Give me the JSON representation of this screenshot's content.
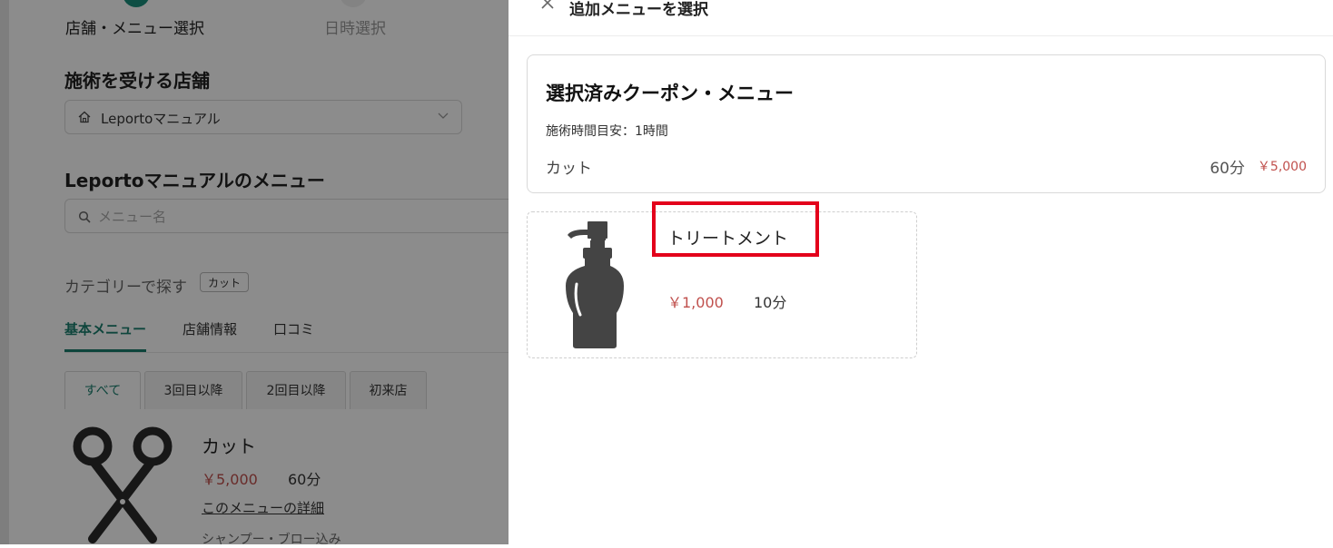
{
  "steps": [
    {
      "label": "店舗・メニュー選択",
      "state": "active"
    },
    {
      "label": "日時選択",
      "state": "inactive"
    }
  ],
  "store_section": {
    "title": "施術を受ける店舗",
    "selected_store": "Leportoマニュアル",
    "icon": "home-icon"
  },
  "menu_section": {
    "title": "Leportoマニュアルのメニュー",
    "search_placeholder": "メニュー名",
    "category_label": "カテゴリーで探す",
    "category_tag": "カット"
  },
  "main_tabs": [
    {
      "label": "基本メニュー",
      "active": true
    },
    {
      "label": "店舗情報",
      "active": false
    },
    {
      "label": "口コミ",
      "active": false
    }
  ],
  "filter_tabs": [
    {
      "label": "すべて",
      "active": true
    },
    {
      "label": "3回目以降",
      "active": false
    },
    {
      "label": "2回目以降",
      "active": false
    },
    {
      "label": "初来店",
      "active": false
    }
  ],
  "menu_item": {
    "name": "カット",
    "price": "￥5,000",
    "duration": "60分",
    "detail_link": "このメニューの詳細",
    "description": "シャンプー・ブロー込み",
    "icon": "scissors-icon"
  },
  "drawer": {
    "title": "追加メニューを選択",
    "selected": {
      "title": "選択済みクーポン・メニュー",
      "time_estimate": "施術時間目安：1時間",
      "item_name": "カット",
      "item_duration": "60分",
      "item_price": "￥5,000"
    },
    "options": [
      {
        "name": "トリートメント",
        "price": "￥1,000",
        "duration": "10分",
        "icon": "pump-bottle-icon"
      }
    ]
  },
  "colors": {
    "accent": "#1a7f6e",
    "price": "#c0504d",
    "highlight": "#e3001b"
  }
}
